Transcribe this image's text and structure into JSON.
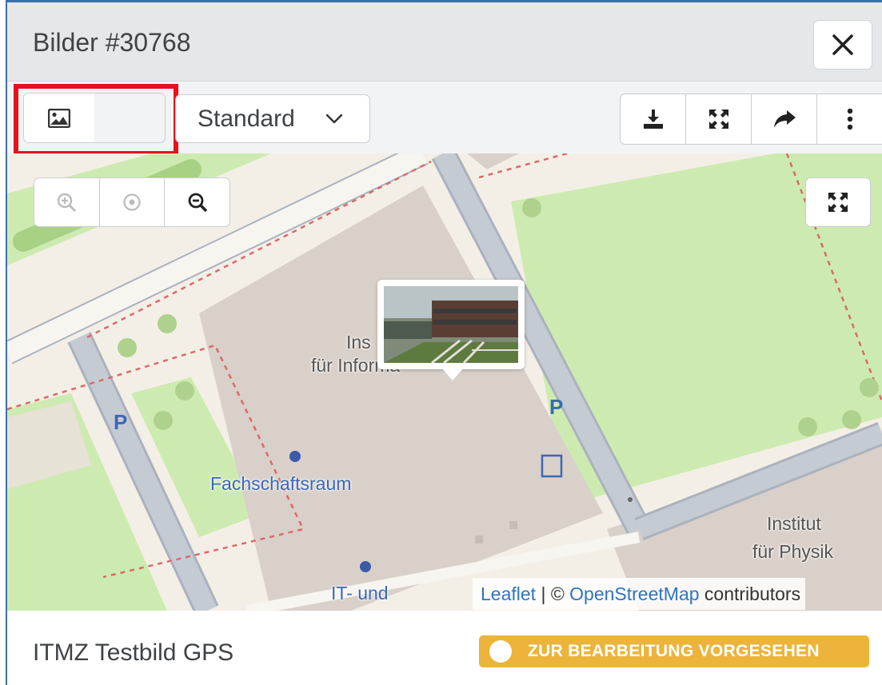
{
  "dialog": {
    "title": "Bilder #30768",
    "close_icon": "close-icon"
  },
  "toolbar": {
    "view_modes": [
      {
        "name": "image-view",
        "icon": "image-icon",
        "selected": false
      },
      {
        "name": "map-view",
        "icon": "map-icon",
        "selected": true
      }
    ],
    "layer_select": {
      "value": "Standard",
      "icon": "chevron-down-icon"
    },
    "actions": [
      {
        "name": "download",
        "icon": "download-icon"
      },
      {
        "name": "fullscreen",
        "icon": "expand-icon"
      },
      {
        "name": "share",
        "icon": "share-icon"
      },
      {
        "name": "more",
        "icon": "more-vertical-icon"
      }
    ],
    "highlight_color": "#e8101c"
  },
  "map": {
    "zoom_controls": [
      {
        "name": "zoom-in",
        "icon": "zoom-in-icon",
        "enabled": false
      },
      {
        "name": "center",
        "icon": "target-icon",
        "enabled": false
      },
      {
        "name": "zoom-out",
        "icon": "zoom-out-icon",
        "enabled": true
      }
    ],
    "fullscreen_icon": "expand-icon",
    "labels": {
      "institute_informatik_line1": "Ins",
      "institute_informatik_line2": "für Informa",
      "fachschaftsraum": "Fachschaftsraum",
      "it_und": "IT- und",
      "physik_line1": "Institut",
      "physik_line2": "für Physik"
    },
    "attribution": {
      "leaflet": "Leaflet",
      "separator": " | © ",
      "osm": "OpenStreetMap",
      "contributors": " contributors"
    },
    "colors": {
      "building": "#d9d0c9",
      "grass": "#cdebb0",
      "road": "#aab2bd",
      "poi_blue": "#3b67b8"
    }
  },
  "footer": {
    "image_title": "ITMZ Testbild GPS",
    "status": {
      "label": "ZUR BEARBEITUNG VORGESEHEN",
      "color": "#ecb43a"
    }
  }
}
